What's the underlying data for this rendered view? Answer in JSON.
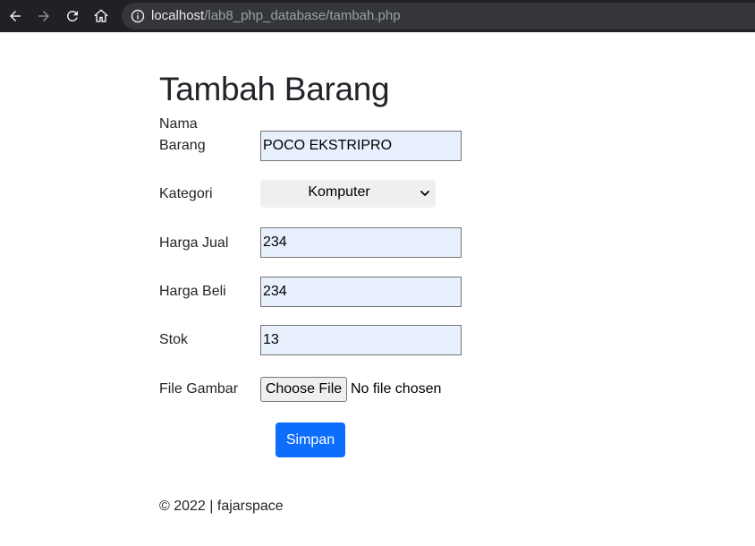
{
  "browser": {
    "url_host": "localhost",
    "url_path": "/lab8_php_database/tambah.php"
  },
  "page": {
    "title": "Tambah Barang"
  },
  "form": {
    "nama_label": "Nama Barang",
    "nama_value": "POCO EKSTRIPRO",
    "kategori_label": "Kategori",
    "kategori_value": "Komputer",
    "harga_jual_label": "Harga Jual",
    "harga_jual_value": "234",
    "harga_beli_label": "Harga Beli",
    "harga_beli_value": "234",
    "stok_label": "Stok",
    "stok_value": "13",
    "file_label": "File Gambar",
    "file_button_label": "Choose File",
    "file_status": "No file chosen",
    "submit_label": "Simpan"
  },
  "footer": {
    "text": "© 2022 | fajarspace"
  },
  "colors": {
    "chrome_bg": "#202124",
    "address_bg": "#35363a",
    "autofill_bg": "#e8f0fe",
    "primary": "#0d6efd"
  }
}
